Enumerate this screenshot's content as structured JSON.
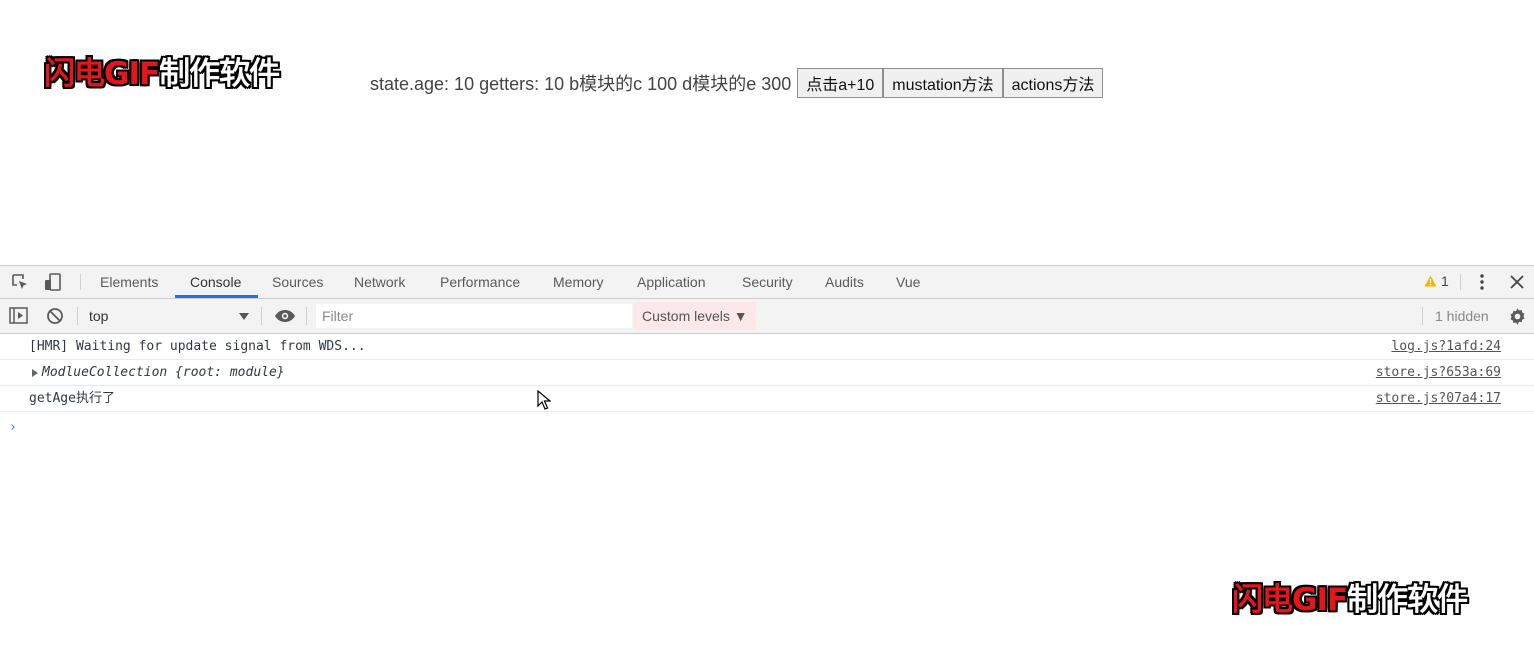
{
  "watermark": {
    "red_text": "闪电GIF",
    "white_text": "制作软件"
  },
  "app": {
    "text": "state.age: 10 getters: 10 b模块的c 100 d模块的e 300",
    "buttons": [
      "点击a+10",
      "mustation方法",
      "actions方法"
    ]
  },
  "devtools": {
    "tabs": [
      "Elements",
      "Console",
      "Sources",
      "Network",
      "Performance",
      "Memory",
      "Application",
      "Security",
      "Audits",
      "Vue"
    ],
    "active_tab": "Console",
    "warning_count": "1",
    "toolbar": {
      "context": "top",
      "filter_placeholder": "Filter",
      "levels": "Custom levels ▼",
      "hidden": "1 hidden"
    },
    "messages": [
      {
        "text": "[HMR] Waiting for update signal from WDS...",
        "source": "log.js?1afd:24"
      },
      {
        "text": "ModlueCollection {root: module}",
        "source": "store.js?653a:69"
      },
      {
        "text": "getAge执行了",
        "source": "store.js?07a4:17"
      }
    ],
    "prompt": "›"
  },
  "colors": {
    "accent": "#1a73e8",
    "watermark_red": "#e4161c",
    "warning": "#f4b400"
  },
  "icons": [
    "inspect-icon",
    "device-toggle-icon",
    "warning-icon",
    "kebab-menu-icon",
    "close-icon",
    "sidebar-toggle-icon",
    "clear-console-icon",
    "eye-icon",
    "gear-icon",
    "mouse-cursor-icon"
  ]
}
